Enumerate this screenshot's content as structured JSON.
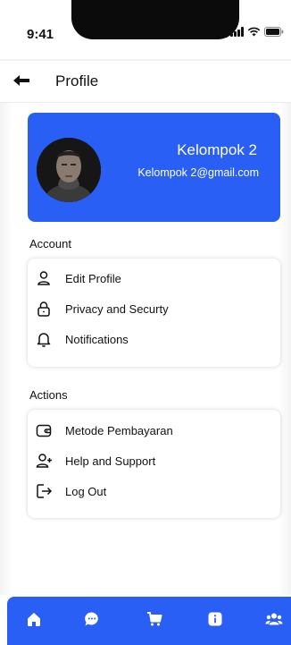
{
  "status_bar": {
    "time": "9:41",
    "icons": [
      "signal-icon",
      "wifi-icon",
      "battery-icon"
    ]
  },
  "header": {
    "back_icon": "arrow-left-icon",
    "title": "Profile"
  },
  "profile": {
    "name": "Kelompok 2",
    "email": "Kelompok 2@gmail.com",
    "avatar": "avatar-photo"
  },
  "account": {
    "label": "Account",
    "items": [
      {
        "label": "Edit Profile",
        "icon": "user-icon"
      },
      {
        "label": "Privacy and Securty",
        "icon": "lock-icon"
      },
      {
        "label": "Notifications",
        "icon": "bell-icon"
      }
    ]
  },
  "actions": {
    "label": "Actions",
    "items": [
      {
        "label": "Metode Pembayaran",
        "icon": "wallet-icon"
      },
      {
        "label": "Help and Support",
        "icon": "user-plus-icon"
      },
      {
        "label": "Log Out",
        "icon": "logout-icon"
      }
    ]
  },
  "bottom_nav": {
    "items": [
      "home-icon",
      "chat-icon",
      "cart-icon",
      "info-icon",
      "users-icon"
    ]
  },
  "colors": {
    "accent": "#2a5ff5",
    "background": "#ffffff",
    "text": "#111111"
  }
}
